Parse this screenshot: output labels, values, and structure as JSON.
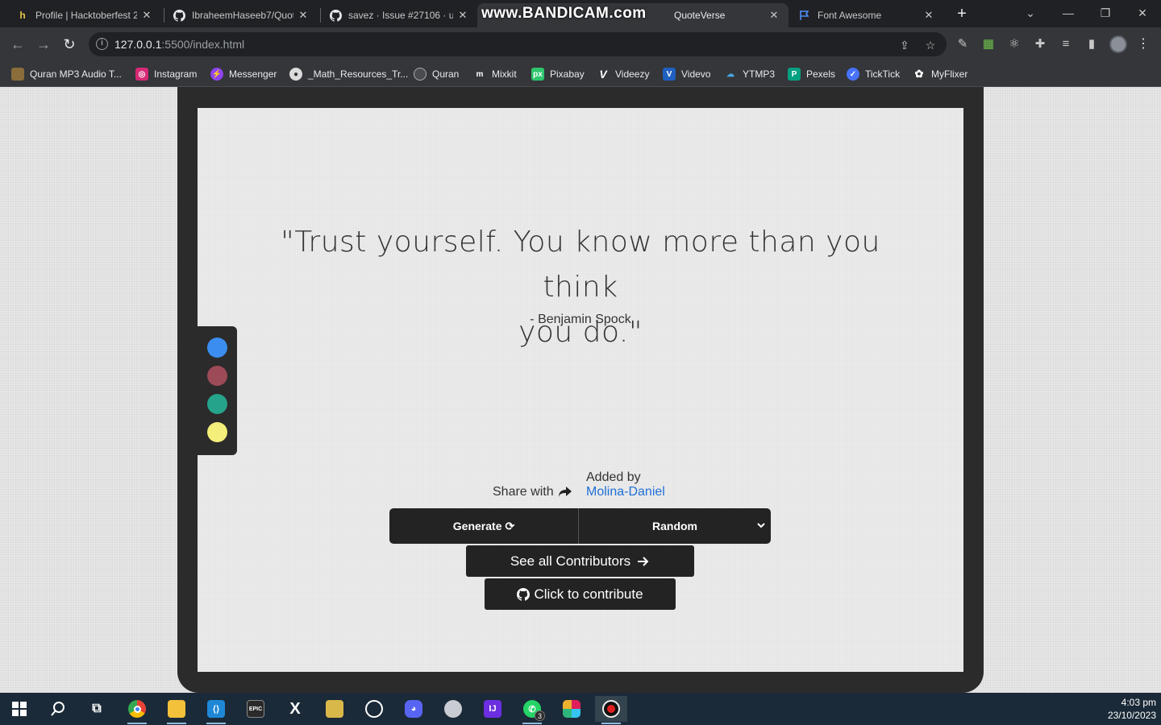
{
  "browser": {
    "tabs": [
      {
        "title": "Profile | Hacktoberfest 2",
        "icon": "hacktoberfest-icon"
      },
      {
        "title": "IbraheemHaseeb7/Quot",
        "icon": "github-icon"
      },
      {
        "title": "savez · Issue #27106 · u",
        "icon": "github-icon"
      },
      {
        "title": "QuoteVerse",
        "icon": "page-icon",
        "active": true
      },
      {
        "title": "Font Awesome",
        "icon": "flag-icon"
      }
    ],
    "watermark": "www.BANDICAM.com",
    "url_host": "127.0.0.1",
    "url_rest": ":5500/index.html",
    "bookmarks": [
      "Quran MP3 Audio T...",
      "Instagram",
      "Messenger",
      "_Math_Resources_Tr...",
      "Quran",
      "Mixkit",
      "Pixabay",
      "Videezy",
      "Videvo",
      "YTMP3",
      "Pexels",
      "TickTick",
      "MyFlixer"
    ]
  },
  "page": {
    "quote_line1": "\"Trust yourself. You know more than you think",
    "quote_line2": "you do.\"",
    "author": "- Benjamin Spock",
    "share_label": "Share with",
    "added_by_label": "Added by",
    "added_by_name": "Molina-Daniel",
    "generate_label": "Generate",
    "select_value": "Random",
    "contributors_label": "See all Contributors",
    "contribute_label": "Click to contribute",
    "palette_colors": [
      "#3b8ef0",
      "#9c4a58",
      "#26a38b",
      "#f4ee7a"
    ],
    "text_color": "#333333",
    "link_color": "#1f6fd6",
    "button_color": "#232323"
  },
  "taskbar": {
    "badge_count": "3",
    "time": "4:03 pm",
    "date": "23/10/2023"
  }
}
